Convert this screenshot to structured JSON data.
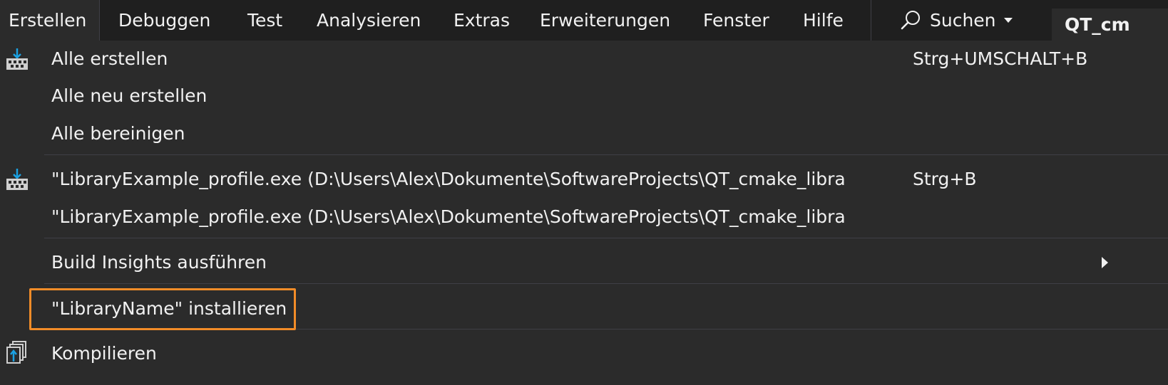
{
  "menubar": {
    "items": [
      {
        "label": "Erstellen",
        "active": true
      },
      {
        "label": "Debuggen"
      },
      {
        "label": "Test"
      },
      {
        "label": "Analysieren"
      },
      {
        "label": "Extras"
      },
      {
        "label": "Erweiterungen"
      },
      {
        "label": "Fenster"
      },
      {
        "label": "Hilfe"
      }
    ],
    "search": {
      "label": "Suchen",
      "icon": "search-icon"
    },
    "solution_tab": "QT_cm"
  },
  "dropdown": {
    "items": [
      {
        "label": "Alle erstellen",
        "shortcut": "Strg+UMSCHALT+B",
        "icon": "build-solution-icon"
      },
      {
        "label": "Alle neu erstellen",
        "shortcut": ""
      },
      {
        "label": "Alle bereinigen",
        "shortcut": ""
      },
      {
        "label": "\"LibraryExample_profile.exe (D:\\Users\\Alex\\Dokumente\\SoftwareProjects\\QT_cmake_libra",
        "shortcut": "Strg+B",
        "icon": "build-project-icon"
      },
      {
        "label": "\"LibraryExample_profile.exe (D:\\Users\\Alex\\Dokumente\\SoftwareProjects\\QT_cmake_libra",
        "shortcut": ""
      },
      {
        "label": "Build Insights ausführen",
        "shortcut": "",
        "submenu": true
      },
      {
        "label": "\"LibraryName\" installieren",
        "shortcut": "",
        "highlighted": true
      },
      {
        "label": "Kompilieren",
        "shortcut": "",
        "icon": "compile-icon"
      }
    ]
  },
  "colors": {
    "menubar_bg": "#1f1f1f",
    "menu_bg": "#2b2b2b",
    "text": "#f1f1f1",
    "divider": "#3f3f46",
    "highlight": "#f28c28",
    "icon_accent": "#1ba1e2"
  }
}
